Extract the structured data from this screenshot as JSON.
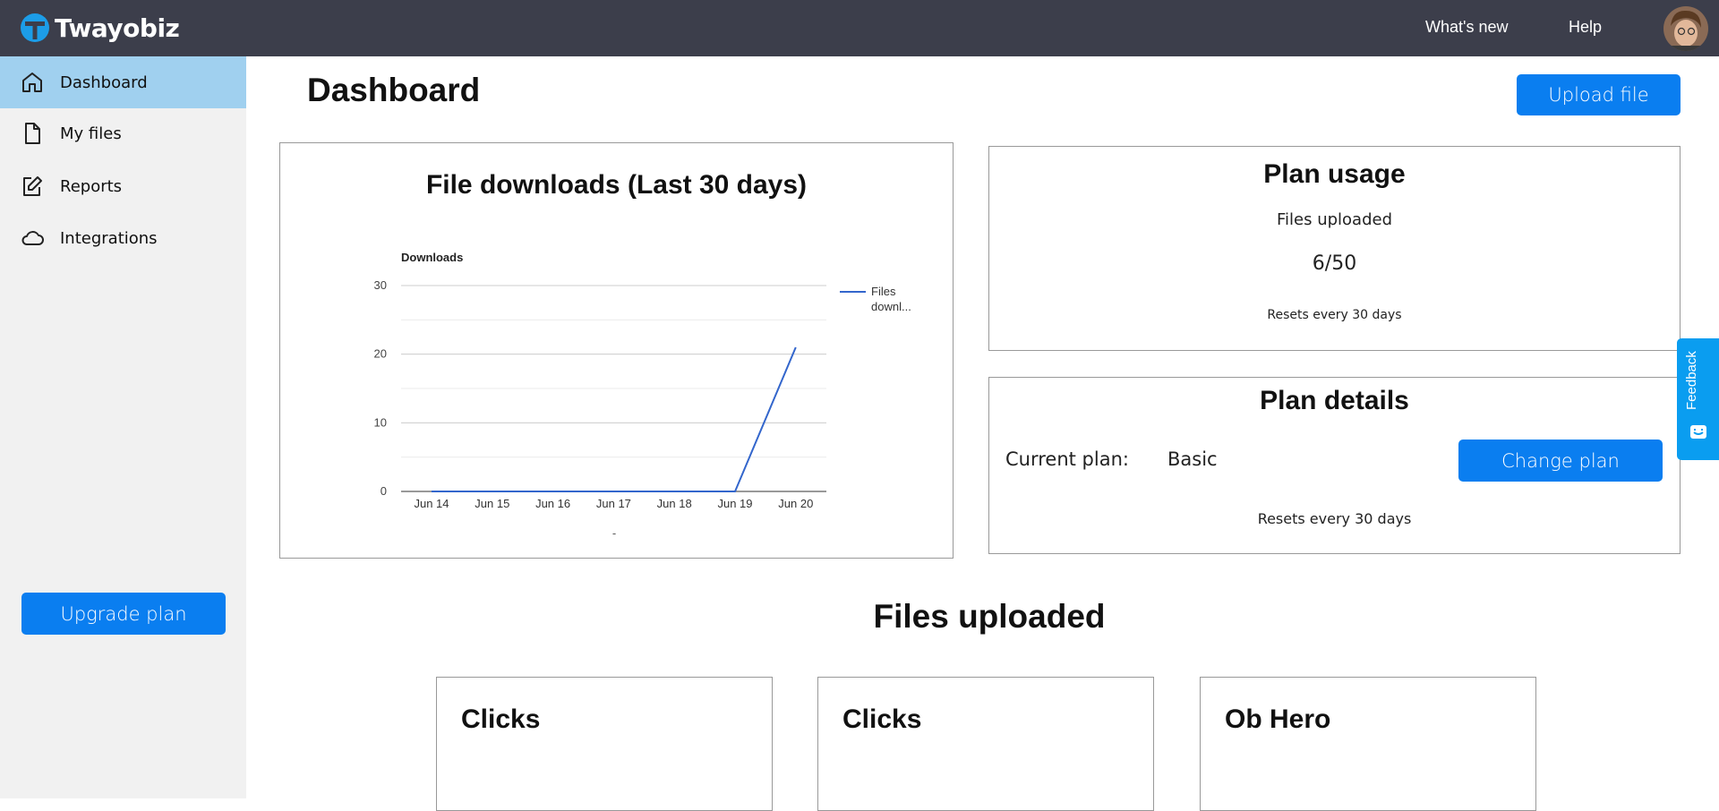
{
  "app": {
    "name": "Twayobiz"
  },
  "topnav": {
    "whats_new": "What's new",
    "help": "Help"
  },
  "sidebar": {
    "items": [
      {
        "label": "Dashboard",
        "icon": "home-icon",
        "active": true
      },
      {
        "label": "My files",
        "icon": "file-icon",
        "active": false
      },
      {
        "label": "Reports",
        "icon": "edit-icon",
        "active": false
      },
      {
        "label": "Integrations",
        "icon": "cloud-icon",
        "active": false
      }
    ],
    "upgrade_label": "Upgrade plan"
  },
  "page": {
    "title": "Dashboard",
    "upload_label": "Upload file"
  },
  "downloads_card": {
    "title": "File downloads (Last 30 days)",
    "x_axis_caption": "-"
  },
  "chart_data": {
    "type": "line",
    "title": "",
    "ylabel": "Downloads",
    "xlabel": "",
    "categories": [
      "Jun 14",
      "Jun 15",
      "Jun 16",
      "Jun 17",
      "Jun 18",
      "Jun 19",
      "Jun 20"
    ],
    "series": [
      {
        "name": "Files downl...",
        "values": [
          0,
          0,
          0,
          0,
          0,
          0,
          21
        ],
        "color": "#3366cc"
      }
    ],
    "ylim": [
      0,
      30
    ],
    "yticks": [
      "0",
      "10",
      "20",
      "30"
    ],
    "grid": true,
    "legend": "right"
  },
  "plan_usage": {
    "title": "Plan usage",
    "label": "Files uploaded",
    "value": "6/50",
    "reset_note": "Resets every 30 days"
  },
  "plan_details": {
    "title": "Plan details",
    "current_plan_label": "Current plan:",
    "current_plan_value": "Basic",
    "change_label": "Change plan",
    "reset_note": "Resets every 30 days"
  },
  "files_section": {
    "title": "Files uploaded",
    "cards": [
      {
        "title": "Clicks"
      },
      {
        "title": "Clicks"
      },
      {
        "title": "Ob Hero"
      }
    ]
  },
  "feedback": {
    "label": "Feedback"
  },
  "colors": {
    "topbar": "#3c3e4b",
    "accent": "#0a7ef0",
    "active_nav": "#a0d0ef",
    "feedback": "#0a9df0",
    "line": "#3366cc"
  }
}
